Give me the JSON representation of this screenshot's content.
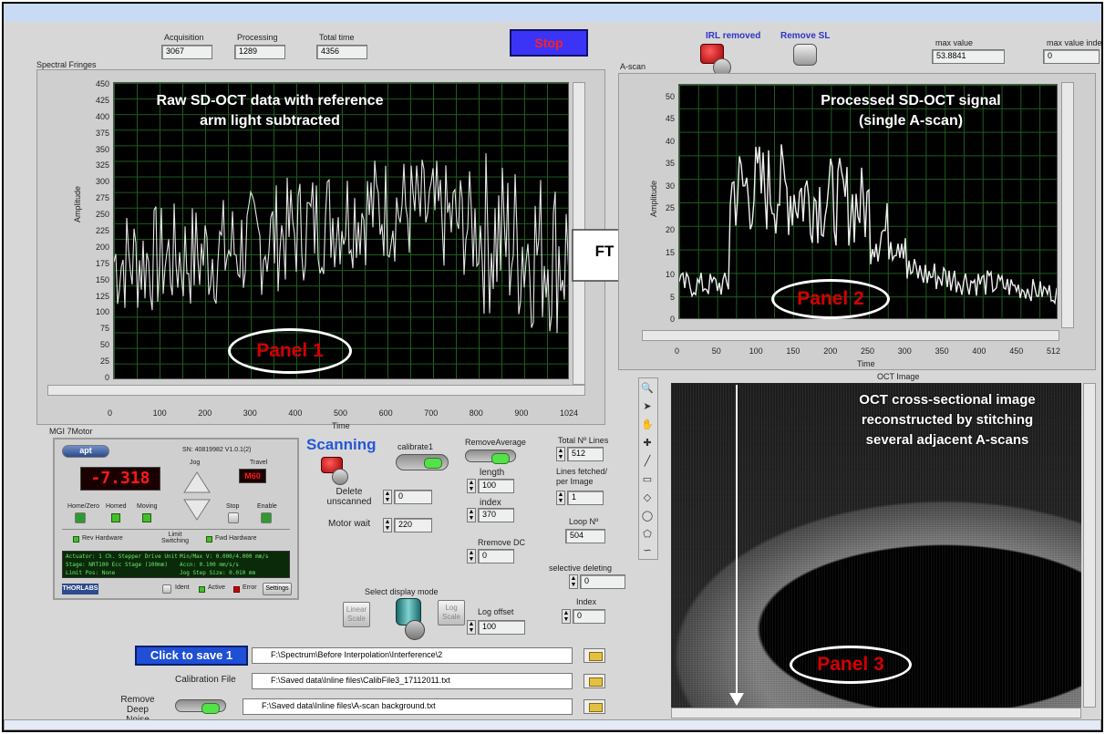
{
  "header": {
    "acquisition_label": "Acquisition",
    "acquisition_value": "3067",
    "processing_label": "Processing",
    "processing_value": "1289",
    "total_time_label": "Total time",
    "total_time_value": "4356",
    "stop_label": "Stop",
    "irl_removed_label": "IRL removed",
    "remove_sl_label": "Remove SL",
    "max_value_label": "max value",
    "max_value_value": "53.8841",
    "max_value_index_label": "max value inde",
    "max_value_index_value": "0"
  },
  "panel1": {
    "title": "Spectral Fringes",
    "overlay": "Raw SD-OCT data with reference\narm light subtracted",
    "callout": "Panel 1",
    "x_label": "Time",
    "y_label": "Amplitude",
    "x_ticks": [
      "0",
      "100",
      "200",
      "300",
      "400",
      "500",
      "600",
      "700",
      "800",
      "900",
      "1024"
    ],
    "y_ticks": [
      "450",
      "425",
      "400",
      "375",
      "350",
      "325",
      "300",
      "275",
      "250",
      "225",
      "200",
      "175",
      "150",
      "125",
      "100",
      "75",
      "50",
      "25",
      "0"
    ]
  },
  "ft_label": "FT",
  "panel2": {
    "title": "A-scan",
    "overlay": "Processed SD-OCT signal\n(single A-scan)",
    "callout": "Panel 2",
    "x_label": "Time",
    "y_label": "Amplitude",
    "x_ticks": [
      "0",
      "50",
      "100",
      "150",
      "200",
      "250",
      "300",
      "350",
      "400",
      "450",
      "512"
    ],
    "y_ticks": [
      "50",
      "45",
      "40",
      "35",
      "30",
      "25",
      "20",
      "15",
      "10",
      "5",
      "0"
    ]
  },
  "panel3": {
    "title": "OCT Image",
    "overlay": "OCT cross-sectional image\nreconstructed by stitching\nseveral adjacent A-scans",
    "callout": "Panel 3"
  },
  "motor": {
    "title": "MGI 7Motor",
    "apt_label": "apt",
    "serial": "SN: 40819982  V1.0.1(2)",
    "jog_label": "Jog",
    "travel_label": "Travel",
    "position_display": "-7.318",
    "travel_display": "M60",
    "home_zero_label": "Home/Zero",
    "homed_label": "Homed",
    "moving_label": "Moving",
    "stop_label": "Stop",
    "enable_label": "Enable",
    "rev_hardware_label": "Rev Hardware",
    "limit_switching_label": "Limit Switching",
    "fwd_hardware_label": "Fwd Hardware",
    "info_line1": "Actuator: 1 Ch. Stepper Drive Unit",
    "info_line2": "Stage: NRT100 Ecc Stage (100mm)",
    "info_line3": "Limit Pos: None",
    "info_line4": "Min/Max V: 0.000/4.000 mm/s",
    "info_line5": "Accn: 0.100 mm/s/s",
    "info_line6": "Jog Step Size: 0.010 mm",
    "thor_label": "THORLABS",
    "ident_label": "Ident",
    "active_label": "Active",
    "error_label": "Error",
    "settings_label": "Settings"
  },
  "controls": {
    "scanning_label": "Scanning",
    "calibrate_label": "calibrate1",
    "remove_average_label": "RemoveAverage",
    "total_lines_label": "Total Nº Lines",
    "total_lines_value": "512",
    "lines_fetched_label": "Lines fetched/ per Image",
    "lines_fetched_value": "1",
    "length_label": "length",
    "length_value": "100",
    "index_label": "index",
    "index_value": "370",
    "delete_unscanned_label": "Delete unscanned",
    "delete_unscanned_value": "0",
    "motor_wait_label": "Motor wait",
    "motor_wait_value": "220",
    "loop_label": "Loop Nº",
    "loop_value": "504",
    "remove_dc_label": "Rremove DC",
    "remove_dc_value": "0",
    "selective_deleting_label": "selective deleting",
    "selective_deleting_value": "0",
    "display_mode_label": "Select display mode",
    "linear_scale_label": "Linear Scale",
    "log_scale_label": "Log Scale",
    "log_offset_label": "Log offset",
    "log_offset_value": "100",
    "index2_label": "Index",
    "index2_value": "0"
  },
  "files": {
    "save_button_label": "Click to save 1",
    "save_path": "F:\\Spectrum\\Before Interpolation\\Interference\\2",
    "calibration_label": "Calibration File",
    "calibration_path": "F:\\Saved data\\Inline files\\CalibFile3_17112011.txt",
    "remove_deep_noise_label": "Remove Deep Noise",
    "noise_path": "F:\\Saved data\\Inline files\\A-scan background.txt"
  },
  "colors": {
    "stop_bg": "#3b34f6",
    "stop_text": "#ff2020",
    "save_bg": "#1f4fd6",
    "plot_bg": "#000000",
    "grid": "#1d5e1d",
    "trace": "#e6e6e6",
    "callout_text": "#d40000",
    "led_display": "#ff1a1a"
  }
}
